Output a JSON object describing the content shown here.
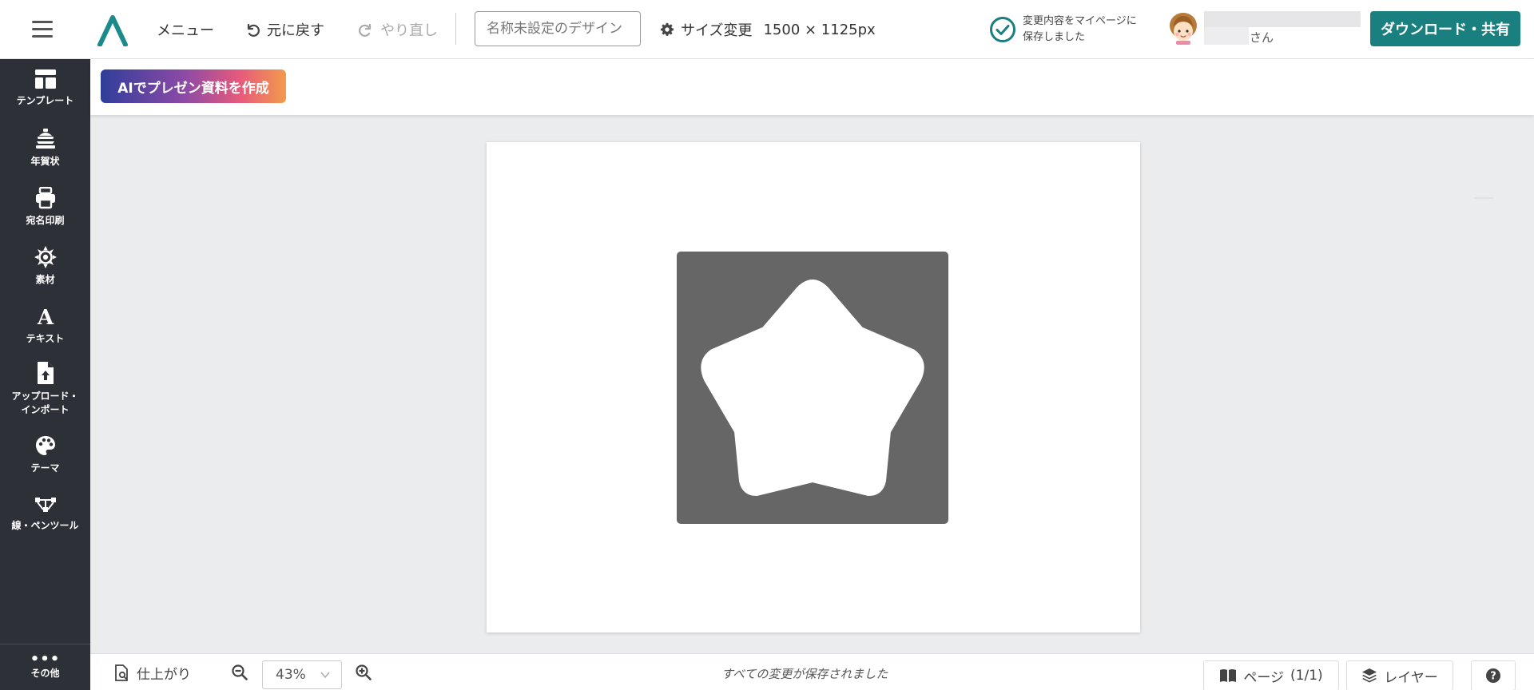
{
  "header": {
    "menu_label": "メニュー",
    "undo_label": "元に戻す",
    "redo_label": "やり直し",
    "design_name_placeholder": "名称未設定のデザイン",
    "resize_label": "サイズ変更",
    "canvas_size": "1500 × 1125px",
    "save_status_line1": "変更内容をマイページに",
    "save_status_line2": "保存しました",
    "username_suffix": "さん",
    "download_label": "ダウンロード・共有"
  },
  "sidebar": {
    "items": [
      {
        "label": "テンプレート",
        "icon": "template-icon"
      },
      {
        "label": "年賀状",
        "icon": "new-year-card-icon"
      },
      {
        "label": "宛名印刷",
        "icon": "printer-icon"
      },
      {
        "label": "素材",
        "icon": "element-icon"
      },
      {
        "label": "テキスト",
        "icon": "text-icon"
      },
      {
        "label": "アップロード・",
        "label2": "インポート",
        "icon": "upload-icon"
      },
      {
        "label": "テーマ",
        "icon": "palette-icon"
      },
      {
        "label": "線・ペンツール",
        "icon": "pen-tool-icon"
      }
    ],
    "more_label": "その他"
  },
  "subbar": {
    "ai_button_label": "AIでプレゼン資料を作成"
  },
  "footer": {
    "finish_label": "仕上がり",
    "zoom_value": "43%",
    "status": "すべての変更が保存されました",
    "page_label": "ページ",
    "page_count": "(1/1)",
    "layer_label": "レイヤー"
  },
  "colors": {
    "accent": "#1a7f7f",
    "sidebar_bg": "#2e3038",
    "shape_fill": "#666666",
    "canvas_bg": "#ebecee"
  }
}
